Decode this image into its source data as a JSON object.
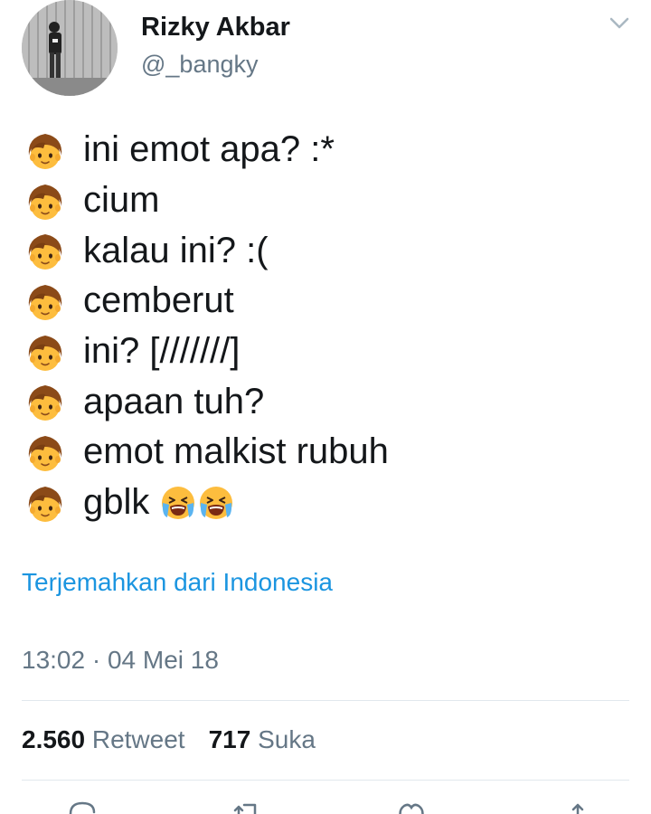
{
  "author": {
    "name": "Rizky Akbar",
    "handle": "@_bangky"
  },
  "icons": {
    "menu": "chevron-down-icon",
    "line_emoji": "boy-emoji-icon",
    "crying_emoji": "loudly-crying-face-icon",
    "reply": "reply-icon",
    "retweet": "retweet-icon",
    "like": "heart-icon",
    "share": "share-icon"
  },
  "lines": [
    "ini emot apa? :*",
    "cium",
    "kalau ini? :(",
    "cemberut",
    "ini? [///////]",
    "apaan tuh?",
    "emot malkist rubuh",
    "gblk"
  ],
  "translate_label": "Terjemahkan dari Indonesia",
  "timestamp": "13:02 · 04 Mei 18",
  "stats": {
    "retweets": "2.560",
    "retweets_label": "Retweet",
    "likes": "717",
    "likes_label": "Suka"
  },
  "colors": {
    "link": "#1b95e0",
    "secondary_text": "#657786",
    "divider": "#e1e8ed"
  }
}
